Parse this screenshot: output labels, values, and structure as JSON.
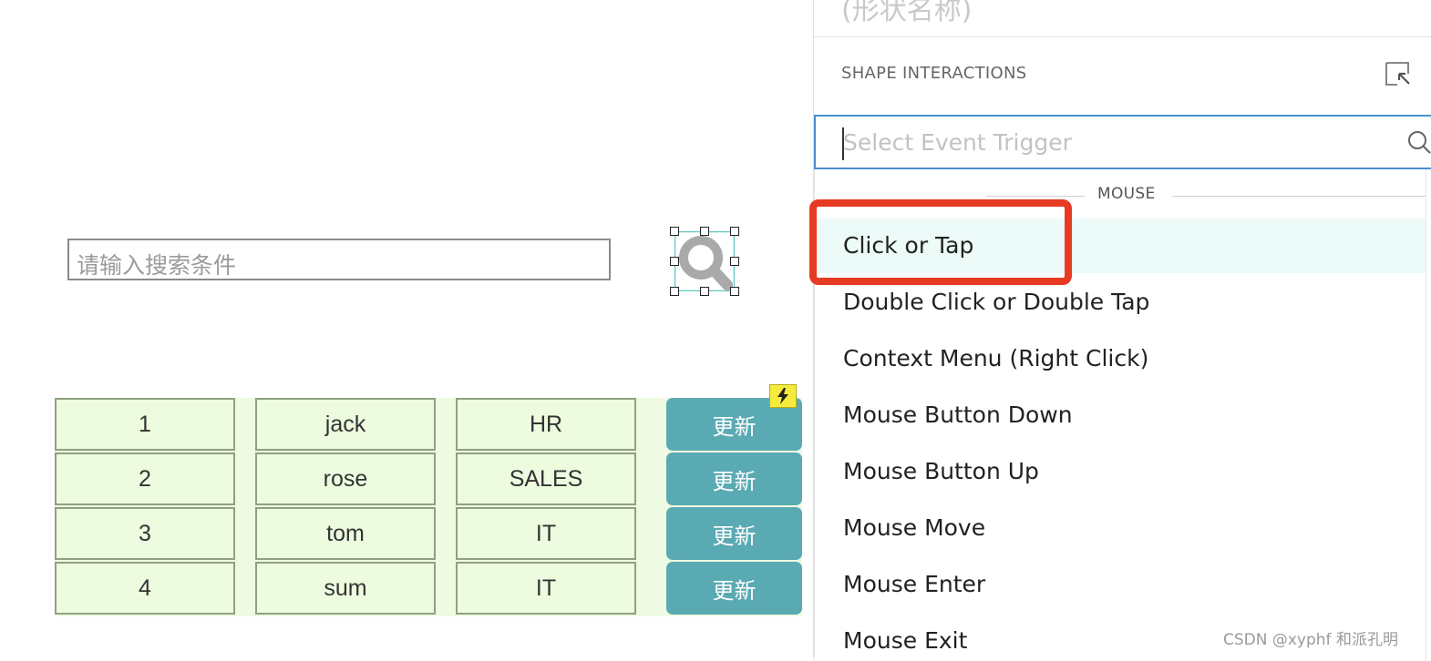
{
  "canvas": {
    "search_placeholder": "请输入搜索条件",
    "table_rows": [
      {
        "id": "1",
        "name": "jack",
        "dept": "HR",
        "action": "更新"
      },
      {
        "id": "2",
        "name": "rose",
        "dept": "SALES",
        "action": "更新"
      },
      {
        "id": "3",
        "name": "tom",
        "dept": "IT",
        "action": "更新"
      },
      {
        "id": "4",
        "name": "sum",
        "dept": "IT",
        "action": "更新"
      }
    ],
    "lightning_icon": "lightning-icon",
    "colors": {
      "table_bg": "#eefbe2",
      "button": "#5aaab3",
      "lightning": "#f6ea3c"
    }
  },
  "panel": {
    "shape_name": "(形状名称)",
    "section_title": "SHAPE INTERACTIONS",
    "trigger_placeholder": "Select Event Trigger",
    "group_label": "MOUSE",
    "options": [
      "Click or Tap",
      "Double Click or Double Tap",
      "Context Menu (Right Click)",
      "Mouse Button Down",
      "Mouse Button Up",
      "Mouse Move",
      "Mouse Enter",
      "Mouse Exit"
    ],
    "selected_option": "Click or Tap",
    "colors": {
      "input_border": "#4a8ed0",
      "selected_bg": "#ecfaf8",
      "highlight": "#e63b22"
    }
  },
  "watermark": "CSDN @xyphf 和派孔明"
}
